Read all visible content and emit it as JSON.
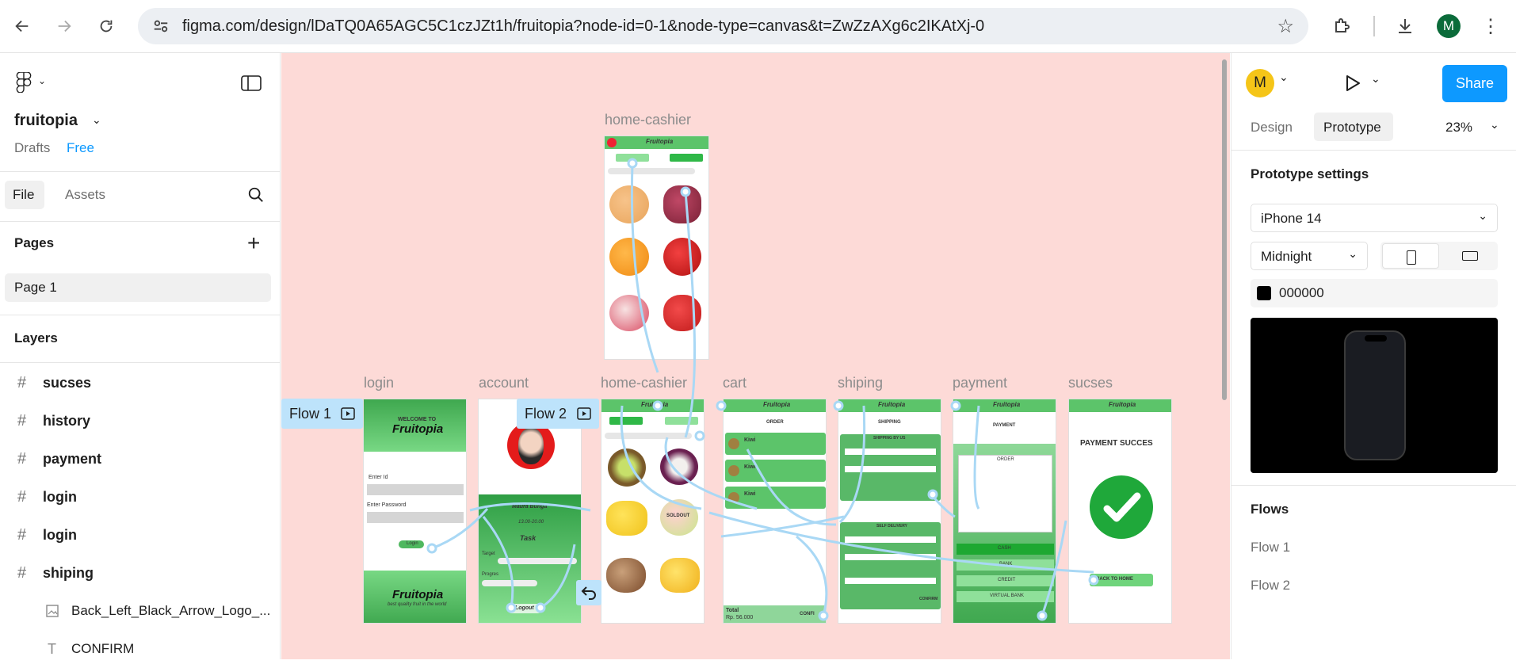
{
  "browser": {
    "url": "figma.com/design/lDaTQ0A65AGC5C1czJZt1h/fruitopia?node-id=0-1&node-type=canvas&t=ZwZzAXg6c2IKAtXj-0",
    "profile_initial": "M"
  },
  "left_panel": {
    "file_name": "fruitopia",
    "drafts": "Drafts",
    "plan": "Free",
    "tabs": [
      "File",
      "Assets"
    ],
    "pages_title": "Pages",
    "page_item": "Page 1",
    "layers_title": "Layers",
    "layers": [
      {
        "name": "sucses",
        "type": "frame"
      },
      {
        "name": "history",
        "type": "frame"
      },
      {
        "name": "payment",
        "type": "frame"
      },
      {
        "name": "login",
        "type": "frame"
      },
      {
        "name": "login",
        "type": "frame"
      },
      {
        "name": "shiping",
        "type": "frame"
      },
      {
        "name": "Back_Left_Black_Arrow_Logo_...",
        "type": "image"
      },
      {
        "name": "CONFIRM",
        "type": "text"
      }
    ]
  },
  "canvas": {
    "top_frame_label": "home-cashier",
    "frame_labels": [
      "login",
      "account",
      "home-cashier",
      "cart",
      "shiping",
      "payment",
      "sucses"
    ],
    "flows": [
      "Flow 1",
      "Flow 2"
    ],
    "login": {
      "welcome": "WELCOME TO",
      "brand": "Fruitopia",
      "enter_id": "Enter Id",
      "enter_password": "Enter Password",
      "login_btn": "Login",
      "tagline": "best quality fruit in the world"
    },
    "account": {
      "name": "Maura Bunga",
      "shift": "13.00-20.00",
      "task": "Task",
      "target": "Target",
      "progres": "Progres",
      "logout": "Logout"
    },
    "home": {
      "title": "Fruitopia",
      "soldout": "SOLDOUT"
    },
    "cart": {
      "title": "Fruitopia",
      "order": "ORDER",
      "item": "Kiwi",
      "total": "Total",
      "total_value": "Rp. 56.000",
      "confirm": "CONFI"
    },
    "shiping": {
      "title": "Fruitopia",
      "header": "SHIPPING",
      "by_us": "SHIPPING BY US",
      "self": "SELF DELIVERY",
      "confirm": "CONFIRM"
    },
    "payment": {
      "title": "Fruitopia",
      "header": "PAYMENT",
      "order": "ORDER",
      "methods": [
        "CASH",
        "BANK",
        "CREDIT",
        "VIRTUAL BANK"
      ]
    },
    "sucses": {
      "title": "Fruitopia",
      "message": "PAYMENT SUCCES",
      "back": "BACK TO HOME"
    }
  },
  "right_panel": {
    "avatar_initial": "M",
    "share": "Share",
    "tabs": [
      "Design",
      "Prototype"
    ],
    "zoom": "23%",
    "settings_title": "Prototype settings",
    "device": "iPhone 14",
    "model": "Midnight",
    "bg_color": "000000",
    "flows_title": "Flows",
    "flows": [
      "Flow 1",
      "Flow 2"
    ]
  },
  "colors": {
    "canvas_bg": "#fddad7",
    "figma_blue": "#0d99ff",
    "fruit_green": "#5cc46a",
    "flow_chip": "#bde3fb"
  }
}
